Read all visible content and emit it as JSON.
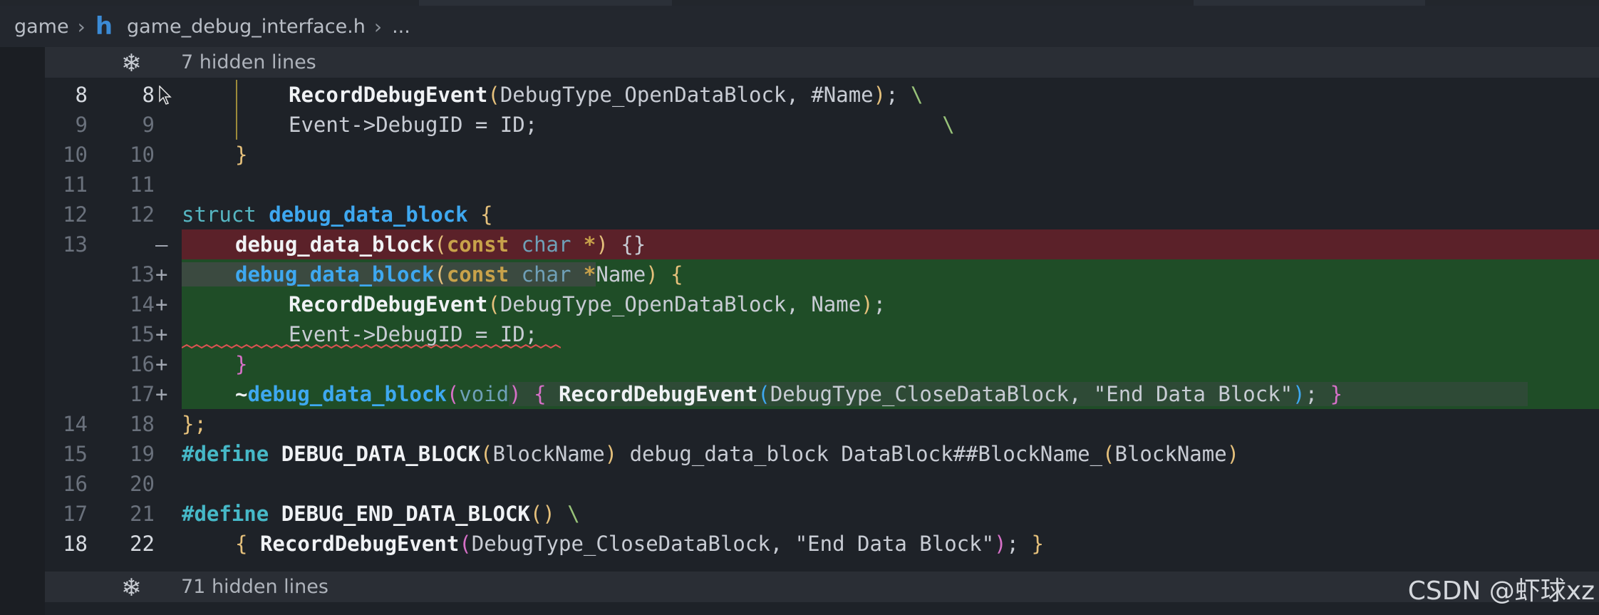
{
  "breadcrumb": {
    "folder": "game",
    "file_icon": "h",
    "file": "game_debug_interface.h",
    "more": "..."
  },
  "hidden_top": {
    "icon": "fold-icon",
    "label": "7 hidden lines"
  },
  "hidden_bottom": {
    "icon": "fold-icon",
    "label": "71 hidden lines"
  },
  "lines": [
    {
      "old": "8",
      "new": "8",
      "mark": ""
    },
    {
      "old": "9",
      "new": "9",
      "mark": ""
    },
    {
      "old": "10",
      "new": "10",
      "mark": ""
    },
    {
      "old": "11",
      "new": "11",
      "mark": ""
    },
    {
      "old": "12",
      "new": "12",
      "mark": ""
    },
    {
      "old": "13",
      "new": "",
      "mark": "—"
    },
    {
      "old": "",
      "new": "13",
      "mark": "+"
    },
    {
      "old": "",
      "new": "14",
      "mark": "+"
    },
    {
      "old": "",
      "new": "15",
      "mark": "+"
    },
    {
      "old": "",
      "new": "16",
      "mark": "+"
    },
    {
      "old": "",
      "new": "17",
      "mark": "+"
    },
    {
      "old": "14",
      "new": "18",
      "mark": ""
    },
    {
      "old": "15",
      "new": "19",
      "mark": ""
    },
    {
      "old": "16",
      "new": "20",
      "mark": ""
    },
    {
      "old": "17",
      "new": "21",
      "mark": ""
    },
    {
      "old": "18",
      "new": "22",
      "mark": ""
    }
  ],
  "code": {
    "l8_call": "RecordDebugEvent",
    "l8_open": "(",
    "l8_args": "DebugType_OpenDataBlock, #Name",
    "l8_close": ")",
    "l8_tail": "; ",
    "l8_bs": "\\",
    "l9_text": "Event->DebugID = ID;",
    "l9_bs": "\\",
    "l10_brace": "}",
    "l12_struct": "struct",
    "l12_name": "debug_data_block",
    "l12_brace": "{",
    "l13d_fn": "debug_data_block",
    "l13d_open": "(",
    "l13d_const": "const",
    "l13d_char": "char",
    "l13d_star": "*",
    "l13d_close": ")",
    "l13d_body": " {}",
    "l13a_fn": "debug_data_block",
    "l13a_open": "(",
    "l13a_const": "const",
    "l13a_char": "char",
    "l13a_star": "*",
    "l13a_name": "Name",
    "l13a_close": ")",
    "l13a_brace": "{",
    "l14_call": "RecordDebugEvent",
    "l14_open": "(",
    "l14_args": "DebugType_OpenDataBlock, Name",
    "l14_close": ")",
    "l14_tail": ";",
    "l15_text": "Event->DebugID = ID;",
    "l16_brace": "}",
    "l17_tilde": "~",
    "l17_fn": "debug_data_block",
    "l17_open": "(",
    "l17_void": "void",
    "l17_close": ")",
    "l17_lb": "{",
    "l17_call": "RecordDebugEvent",
    "l17_copen": "(",
    "l17_args": "DebugType_CloseDataBlock, \"End Data Block\"",
    "l17_cclose": ")",
    "l17_semi": ";",
    "l17_rb": "}",
    "l18_text": "};",
    "l19_def": "#define",
    "l19_macro": "DEBUG_DATA_BLOCK",
    "l19_open": "(",
    "l19_arg": "BlockName",
    "l19_close": ")",
    "l19_body": " debug_data_block DataBlock##BlockName_",
    "l19_open2": "(",
    "l19_arg2": "BlockName",
    "l19_close2": ")",
    "l21_def": "#define",
    "l21_macro": "DEBUG_END_DATA_BLOCK",
    "l21_parens": "()",
    "l21_bs": "\\",
    "l22_lb": "{",
    "l22_call": "RecordDebugEvent",
    "l22_open": "(",
    "l22_args": "DebugType_CloseDataBlock, \"End Data Block\"",
    "l22_close": ")",
    "l22_semi": ";",
    "l22_rb": "}"
  },
  "watermark": "CSDN @虾球xz",
  "colors": {
    "deleted_bg": "#5b2129",
    "added_bg": "#1f4d27",
    "function": "#3ea8f0",
    "keyword": "#c8a24a"
  }
}
